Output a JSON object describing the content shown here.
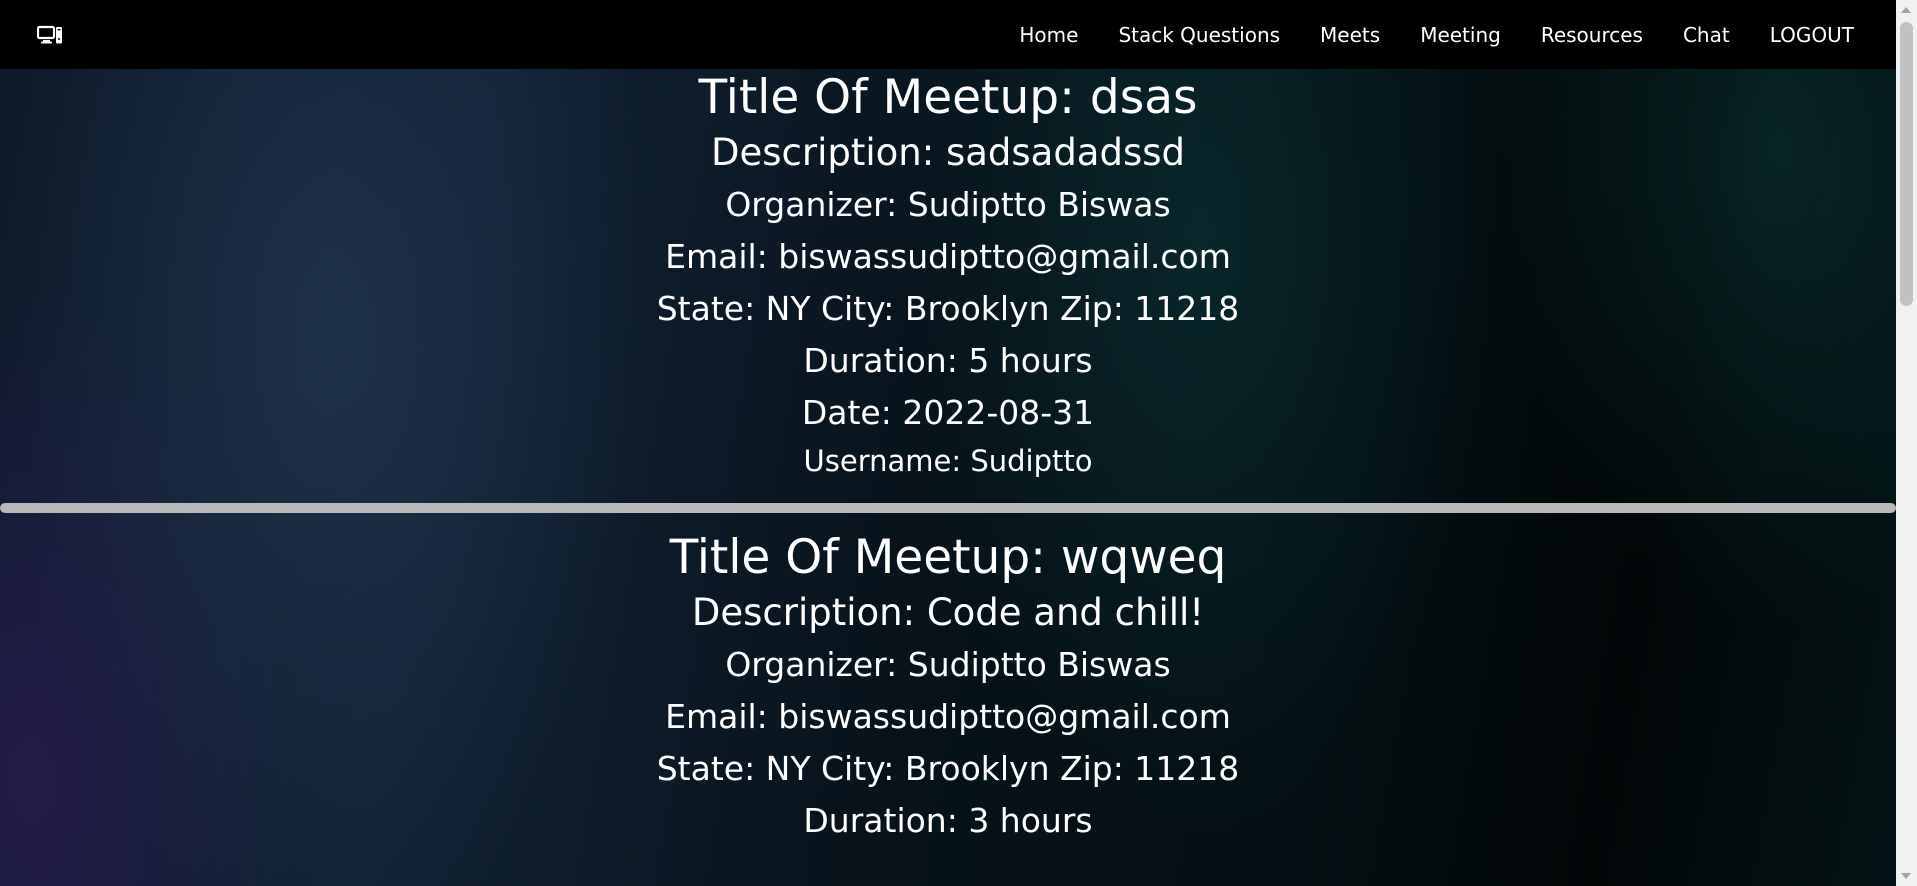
{
  "nav": {
    "logo_icon": "computer-icon",
    "links": [
      "Home",
      "Stack Questions",
      "Meets",
      "Meeting",
      "Resources",
      "Chat",
      "LOGOUT"
    ]
  },
  "meetups": [
    {
      "title": "Title Of Meetup: dsas",
      "description": "Description: sadsadadssd",
      "organizer": "Organizer: Sudiptto Biswas",
      "email": "Email: biswassudiptto@gmail.com",
      "location": "State: NY City: Brooklyn Zip: 11218",
      "duration": "Duration: 5 hours",
      "date": "Date: 2022-08-31",
      "username": "Username: Sudiptto"
    },
    {
      "title": "Title Of Meetup: wqweq",
      "description": "Description: Code and chill!",
      "organizer": "Organizer: Sudiptto Biswas",
      "email": "Email: biswassudiptto@gmail.com",
      "location": "State: NY City: Brooklyn Zip: 11218",
      "duration": "Duration: 3 hours"
    }
  ],
  "colors": {
    "navbar": "#000000",
    "text": "#ffffff",
    "separator": "#b8b8b8"
  }
}
